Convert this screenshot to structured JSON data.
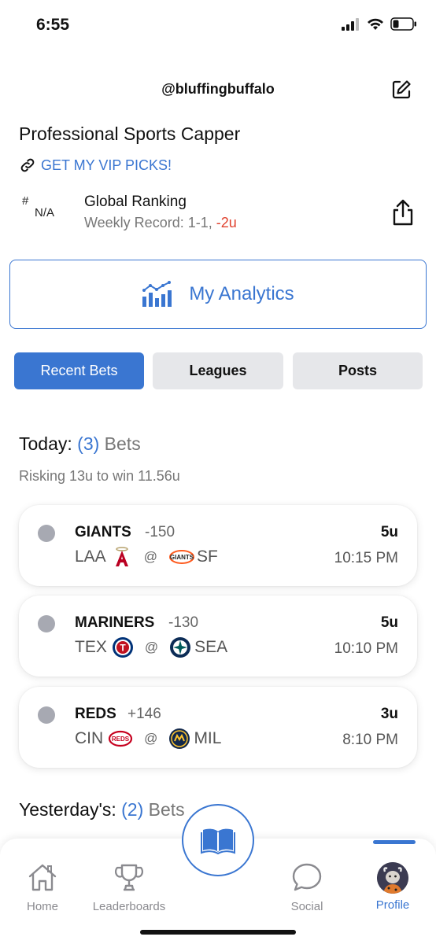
{
  "status_bar": {
    "time": "6:55"
  },
  "header": {
    "handle": "@bluffingbuffalo"
  },
  "profile": {
    "bio": "Professional Sports Capper",
    "link_text": "GET MY VIP PICKS!"
  },
  "ranking": {
    "hash": "#",
    "value": "N/A",
    "title": "Global Ranking",
    "record_label": "Weekly Record: 1-1, ",
    "record_units": "-2u"
  },
  "analytics": {
    "label": "My Analytics"
  },
  "tabs": [
    {
      "label": "Recent Bets"
    },
    {
      "label": "Leagues"
    },
    {
      "label": "Posts"
    }
  ],
  "today": {
    "prefix": "Today: ",
    "count": "(3)",
    "suffix": " Bets",
    "risk": "Risking 13u to win 11.56u"
  },
  "bets": [
    {
      "team": "GIANTS",
      "odds": "-150",
      "units": "5u",
      "away": "LAA",
      "at": "@",
      "home": "SF",
      "time": "10:15 PM"
    },
    {
      "team": "MARINERS",
      "odds": "-130",
      "units": "5u",
      "away": "TEX",
      "at": "@",
      "home": "SEA",
      "time": "10:10 PM"
    },
    {
      "team": "REDS",
      "odds": "+146",
      "units": "3u",
      "away": "CIN",
      "at": "@",
      "home": "MIL",
      "time": "8:10 PM"
    }
  ],
  "yesterday": {
    "prefix": "Yesterday's: ",
    "count": "(2)",
    "suffix": " Bets"
  },
  "nav": {
    "home": "Home",
    "leaderboards": "Leaderboards",
    "social": "Social",
    "profile": "Profile"
  },
  "colors": {
    "accent": "#3a76d1",
    "negative": "#e0412e",
    "tab_inactive": "#e6e7ea",
    "pending_dot": "#a7a9b2"
  },
  "team_logos": {
    "LAA": "angels-logo",
    "SF": "giants-logo",
    "TEX": "rangers-logo",
    "SEA": "mariners-logo",
    "CIN": "reds-logo",
    "MIL": "brewers-logo"
  }
}
